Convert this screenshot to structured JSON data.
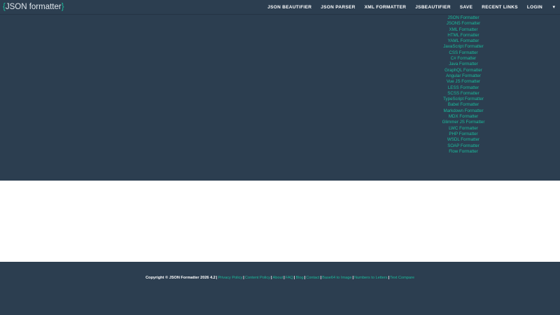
{
  "brand": {
    "open_bracket": "{",
    "name": "JSON formatter",
    "close_bracket": "}"
  },
  "nav": {
    "items": [
      {
        "label": "JSON BEAUTIFIER"
      },
      {
        "label": "JSON PARSER"
      },
      {
        "label": "XML FORMATTER"
      },
      {
        "label": "JSBEAUTIFIER"
      },
      {
        "label": "SAVE"
      },
      {
        "label": "RECENT LINKS"
      },
      {
        "label": "LOGIN"
      }
    ],
    "caret": "▾"
  },
  "dropdown": {
    "items": [
      "JSON Formatter",
      "JSON5 Formatter",
      "XML Formatter",
      "HTML Formatter",
      "YAML Formatter",
      "JavaScript Formatter",
      "CSS Formatter",
      "C# Formatter",
      "Java Formatter",
      "GraphQL Formatter",
      "Angular Formatter",
      "Vue JS Formatter",
      "LESS Formatter",
      "SCSS Formatter",
      "TypeScript Formatter",
      "Babel Formatter",
      "Markdown Formatter",
      "MDX Formatter",
      "Glimmer JS Formatter",
      "LWC Formatter",
      "PHP Formatter",
      "WSDL Formatter",
      "SOAP Formatter",
      "Flow Formatter"
    ]
  },
  "footer": {
    "copyright": "Copyright © JSON Formatter 2026 4.2",
    "separator": "|",
    "links": [
      "Privacy Policy",
      "Content Policy",
      "About",
      "FAQ",
      "Blog",
      "Contact",
      "Base64 to Image",
      "Numbers to Letters",
      "Text Compare"
    ]
  },
  "colors": {
    "navy": "#2c3e50",
    "accent": "#1abc9c",
    "white": "#ffffff"
  }
}
